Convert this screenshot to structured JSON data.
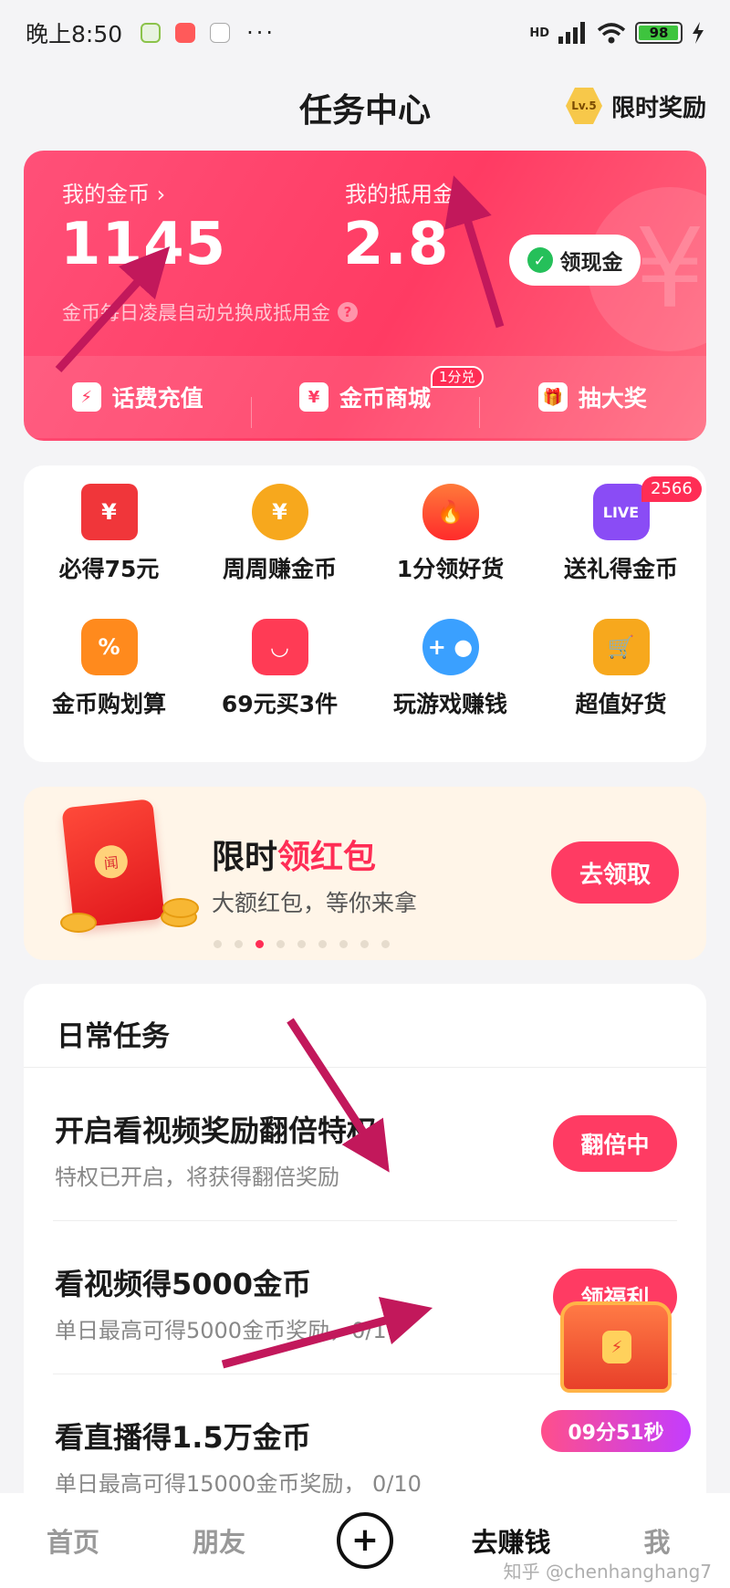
{
  "status_bar": {
    "time": "晚上8:50",
    "more": "···",
    "network": "HD",
    "battery": "98"
  },
  "header": {
    "title": "任务中心",
    "level_badge": "Lv.5",
    "reward_label": "限时奖励"
  },
  "wallet": {
    "coins_label": "我的金币 ›",
    "coins_value": "1145",
    "credit_label": "我的抵用金 ›",
    "credit_value": "2.8",
    "cash_button": "领现金",
    "hint": "金币每日凌晨自动兑换成抵用金",
    "bottom": [
      {
        "label": "话费充值",
        "icon": "phone-bill-icon"
      },
      {
        "label": "金币商城",
        "icon": "coin-mall-icon",
        "tag": "1分兑"
      },
      {
        "label": "抽大奖",
        "icon": "gift-icon"
      }
    ]
  },
  "shortcuts": [
    {
      "label": "必得75元",
      "icon": "red-envelope-icon",
      "color": "#f0363a"
    },
    {
      "label": "周周赚金币",
      "icon": "yen-coin-icon",
      "color": "#f7a81d"
    },
    {
      "label": "1分领好货",
      "icon": "flame-icon",
      "color": "#ff4a2b"
    },
    {
      "label": "送礼得金币",
      "icon": "live-icon",
      "color": "#8a4cf5",
      "badge": "2566"
    },
    {
      "label": "金币购划算",
      "icon": "shopping-bag-icon",
      "color": "#ff8a1d"
    },
    {
      "label": "69元买3件",
      "icon": "gift-box-icon",
      "color": "#ff3b55"
    },
    {
      "label": "玩游戏赚钱",
      "icon": "gamepad-icon",
      "color": "#3aa0ff"
    },
    {
      "label": "超值好货",
      "icon": "cart-icon",
      "color": "#f7a81d"
    }
  ],
  "promo": {
    "title_plain": "限时",
    "title_highlight": "领红包",
    "subtitle": "大额红包，等你来拿",
    "button": "去领取",
    "dots_total": 9,
    "dots_active": 3
  },
  "tasks": {
    "heading": "日常任务",
    "items": [
      {
        "title": "开启看视频奖励翻倍特权",
        "subtitle": "特权已开启，将获得翻倍奖励",
        "button": "翻倍中"
      },
      {
        "title": "看视频得5000金币",
        "subtitle": "单日最高可得5000金币奖励，0/10",
        "button": "领福利"
      },
      {
        "title": "看直播得1.5万金币",
        "subtitle": "单日最高可得15000金币奖励， 0/10",
        "button": ""
      }
    ]
  },
  "floating_chest": {
    "timer": "09分51秒"
  },
  "bottom_nav": [
    {
      "label": "首页",
      "active": false
    },
    {
      "label": "朋友",
      "active": false
    },
    {
      "label": "+",
      "active": false
    },
    {
      "label": "去赚钱",
      "active": true
    },
    {
      "label": "我",
      "active": false
    }
  ],
  "watermark": "知乎 @chenhanghang7",
  "colors": {
    "accent": "#ff3b63",
    "annotation_arrow": "#c2185b"
  }
}
